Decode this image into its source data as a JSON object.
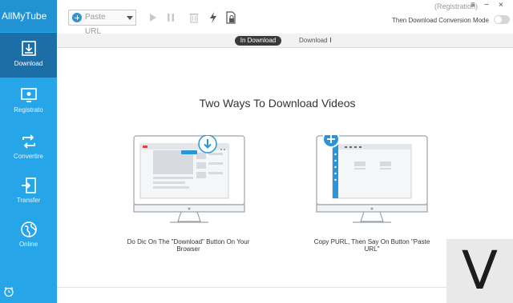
{
  "app": {
    "title": "AllMyTube"
  },
  "sidebar": {
    "items": [
      {
        "label": "Download",
        "icon": "download-icon",
        "active": true
      },
      {
        "label": "Registrato",
        "icon": "monitor-record-icon",
        "active": false
      },
      {
        "label": "Convertire",
        "icon": "convert-icon",
        "active": false
      },
      {
        "label": "Transfer",
        "icon": "transfer-icon",
        "active": false
      },
      {
        "label": "Online",
        "icon": "globe-icon",
        "active": false
      }
    ],
    "bottom_icon": "alarm-clock-icon"
  },
  "toolbar": {
    "paste_label": "Paste URL",
    "registration_label": "(Registration)",
    "conversion_mode_label": "Then Download Conversion Mode",
    "conversion_mode_on": false,
    "win_menu": "≡",
    "win_minimize": "−",
    "win_close": "×"
  },
  "tabs": {
    "active": "In Download",
    "inactive": "Download"
  },
  "main": {
    "heading": "Two Ways To Download Videos",
    "left_caption": "Do Dic On The \"Download\" Button On Your Browser",
    "right_caption": "Copy PURL, Then Say On Button \"Paste URL\""
  },
  "watermark": {
    "letter": "V"
  },
  "colors": {
    "sidebar": "#26a6e8",
    "sidebar_active": "#1b6ea6",
    "accent": "#2a95d8"
  }
}
